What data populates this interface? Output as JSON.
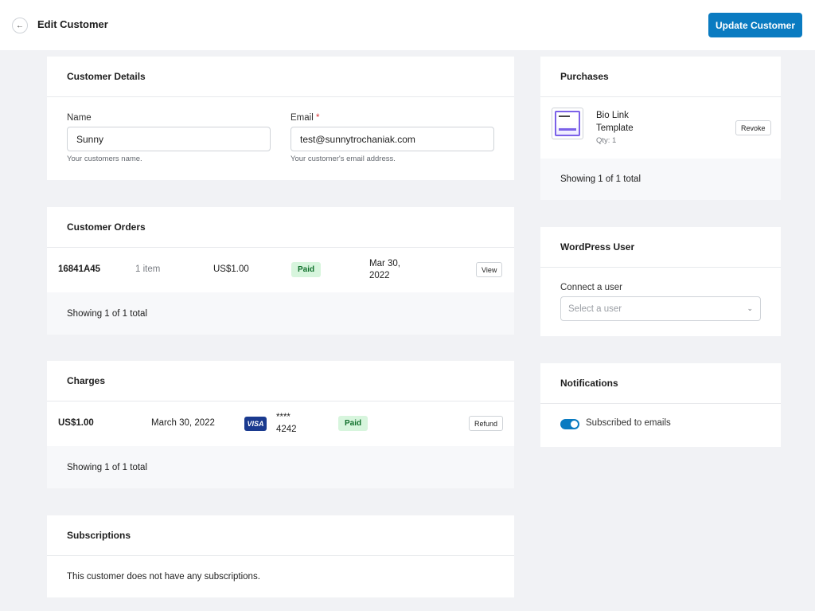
{
  "header": {
    "title": "Edit Customer",
    "update_button": "Update Customer"
  },
  "customer_details": {
    "title": "Customer Details",
    "name_label": "Name",
    "name_value": "Sunny",
    "name_help": "Your customers name.",
    "email_label": "Email",
    "email_required_mark": "*",
    "email_value": "test@sunnytrochaniak.com",
    "email_help": "Your customer's email address."
  },
  "customer_orders": {
    "title": "Customer Orders",
    "rows": [
      {
        "id": "16841A45",
        "items": "1 item",
        "amount": "US$1.00",
        "status": "Paid",
        "date_line1": "Mar 30,",
        "date_line2": "2022",
        "action": "View"
      }
    ],
    "footer": "Showing 1 of 1 total"
  },
  "charges": {
    "title": "Charges",
    "rows": [
      {
        "amount": "US$1.00",
        "date": "March 30, 2022",
        "card_brand": "VISA",
        "card_line1": "****",
        "card_line2": "4242",
        "status": "Paid",
        "action": "Refund"
      }
    ],
    "footer": "Showing 1 of 1 total"
  },
  "subscriptions": {
    "title": "Subscriptions",
    "empty_text": "This customer does not have any subscriptions."
  },
  "purchases": {
    "title": "Purchases",
    "items": [
      {
        "name_line1": "Bio Link",
        "name_line2": "Template",
        "qty": "Qty: 1",
        "action": "Revoke"
      }
    ],
    "footer": "Showing 1 of 1 total"
  },
  "wordpress_user": {
    "title": "WordPress User",
    "label": "Connect a user",
    "placeholder": "Select a user"
  },
  "notifications": {
    "title": "Notifications",
    "toggle_label": "Subscribed to emails",
    "toggle_on": true
  },
  "colors": {
    "primary": "#0a7bc1",
    "badge_bg": "#d7f5dd",
    "badge_text": "#10702c",
    "background": "#f1f2f5"
  }
}
